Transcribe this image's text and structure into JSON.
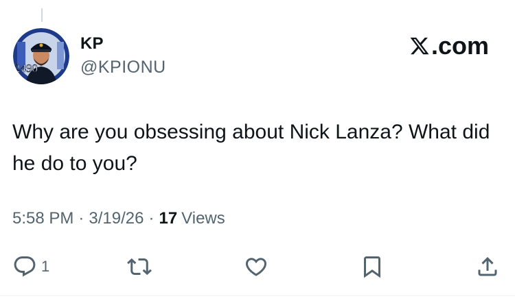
{
  "author": {
    "name": "KP",
    "handle": "@KPIONU",
    "avatar_badge_text": "2490"
  },
  "brand": {
    "label": ".com",
    "icon": "x-logo-icon"
  },
  "tweet": {
    "text": "Why are you obsessing about Nick Lanza? What did he do to you?"
  },
  "meta": {
    "time": "5:58 PM",
    "separator": "·",
    "date": "3/19/26",
    "views_count": "17",
    "views_label": "Views"
  },
  "actions": {
    "reply": {
      "icon": "reply-icon",
      "count": "1"
    },
    "retweet": {
      "icon": "retweet-icon"
    },
    "like": {
      "icon": "heart-icon"
    },
    "bookmark": {
      "icon": "bookmark-icon"
    },
    "share": {
      "icon": "share-icon"
    }
  },
  "colors": {
    "text": "#0f1419",
    "secondary": "#536471",
    "avatar_ring": "#1d3b8a"
  }
}
